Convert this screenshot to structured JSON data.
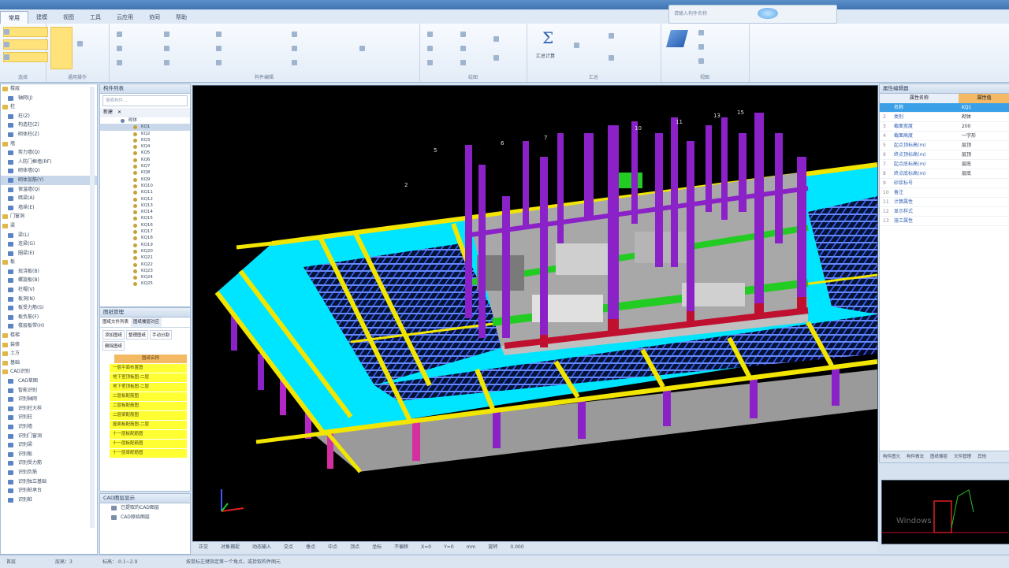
{
  "ribbon": {
    "tabs": [
      "常用",
      "建模",
      "视图",
      "工具",
      "云应用",
      "协同",
      "帮助"
    ],
    "groups": [
      "选择",
      "通用操作",
      "构件编辑",
      "绘图",
      "汇总",
      "视图"
    ],
    "summary_symbol": "Σ",
    "summary_label": "汇总计算",
    "search_placeholder": "请输入构件名称"
  },
  "nav_tree": {
    "items": [
      {
        "label": "楼层",
        "type": "folder"
      },
      {
        "label": "轴网(J)",
        "type": "item"
      },
      {
        "label": "柱",
        "type": "folder"
      },
      {
        "label": "柱(Z)",
        "type": "item"
      },
      {
        "label": "构造柱(Z)",
        "type": "item"
      },
      {
        "label": "砌体柱(Z)",
        "type": "item"
      },
      {
        "label": "墙",
        "type": "folder"
      },
      {
        "label": "剪力墙(Q)",
        "type": "item"
      },
      {
        "label": "人防门框墙(RF)",
        "type": "item"
      },
      {
        "label": "砌体墙(Q)",
        "type": "item"
      },
      {
        "label": "砌体加筋(Y)",
        "type": "item",
        "selected": true
      },
      {
        "label": "保温墙(Q)",
        "type": "item"
      },
      {
        "label": "暗梁(A)",
        "type": "item"
      },
      {
        "label": "墙垛(E)",
        "type": "item"
      },
      {
        "label": "门窗洞",
        "type": "folder"
      },
      {
        "label": "梁",
        "type": "folder"
      },
      {
        "label": "梁(L)",
        "type": "item"
      },
      {
        "label": "连梁(G)",
        "type": "item"
      },
      {
        "label": "圈梁(E)",
        "type": "item"
      },
      {
        "label": "板",
        "type": "folder"
      },
      {
        "label": "现浇板(B)",
        "type": "item"
      },
      {
        "label": "螺旋板(B)",
        "type": "item"
      },
      {
        "label": "柱帽(V)",
        "type": "item"
      },
      {
        "label": "板洞(N)",
        "type": "item"
      },
      {
        "label": "板受力筋(S)",
        "type": "item"
      },
      {
        "label": "板负筋(F)",
        "type": "item"
      },
      {
        "label": "楼层板带(H)",
        "type": "item"
      },
      {
        "label": "楼梯",
        "type": "folder"
      },
      {
        "label": "装修",
        "type": "folder"
      },
      {
        "label": "土方",
        "type": "folder"
      },
      {
        "label": "基础",
        "type": "folder"
      },
      {
        "label": "CAD识别",
        "type": "folder"
      },
      {
        "label": "CAD草图",
        "type": "item"
      },
      {
        "label": "智能识别",
        "type": "item"
      },
      {
        "label": "识别轴网",
        "type": "item"
      },
      {
        "label": "识别柱大样",
        "type": "item"
      },
      {
        "label": "识别柱",
        "type": "item"
      },
      {
        "label": "识别墙",
        "type": "item"
      },
      {
        "label": "识别门窗洞",
        "type": "item"
      },
      {
        "label": "识别梁",
        "type": "item"
      },
      {
        "label": "识别板",
        "type": "item"
      },
      {
        "label": "识别受力筋",
        "type": "item"
      },
      {
        "label": "识别负筋",
        "type": "item"
      },
      {
        "label": "识别独立基础",
        "type": "item"
      },
      {
        "label": "识别桩承台",
        "type": "item"
      },
      {
        "label": "识别桩",
        "type": "item"
      }
    ]
  },
  "component_list": {
    "title": "构件列表",
    "search_placeholder": "搜索构件...",
    "new_label": "新建",
    "delete_label": "✕",
    "root": "砌体",
    "items": [
      "KQ1",
      "KQ2",
      "KQ3",
      "KQ4",
      "KQ5",
      "KQ6",
      "KQ7",
      "KQ8",
      "KQ9",
      "KQ10",
      "KQ11",
      "KQ12",
      "KQ13",
      "KQ14",
      "KQ15",
      "KQ16",
      "KQ17",
      "KQ18",
      "KQ19",
      "KQ20",
      "KQ21",
      "KQ22",
      "KQ23",
      "KQ24",
      "KQ25"
    ]
  },
  "drawing_manager": {
    "title": "图纸管理",
    "tabs": [
      "图纸文件列表",
      "图纸楼层对应"
    ],
    "buttons": [
      "添加图纸",
      "整理图纸",
      "手动分割",
      "删除图纸"
    ],
    "column": "图纸名称",
    "sheets": [
      "一层平面布置图",
      "地下室顶板图-二层",
      "地下室顶板图-二层",
      "二层板配筋图",
      "二层板配筋图",
      "二层梁配筋图",
      "屋面板配筋图-二层",
      "十一层板配筋图",
      "十一层板配筋图",
      "十一层梁配筋图"
    ]
  },
  "cad_layers": {
    "title": "CAD图层显示",
    "items": [
      "已提取的CAD图层",
      "CAD原始图层"
    ]
  },
  "viewport": {
    "toolbar": [
      "正交",
      "对象捕捉",
      "动态输入",
      "交点",
      "垂点",
      "中点",
      "顶点",
      "坐标",
      "不偏移",
      "X=0",
      "Y=0",
      "mm",
      "旋转",
      "0.000"
    ]
  },
  "properties": {
    "title": "属性编辑器",
    "columns": [
      "属性名称",
      "属性值"
    ],
    "rows": [
      {
        "n": "1",
        "k": "名称",
        "v": "KQ1"
      },
      {
        "n": "2",
        "k": "类别",
        "v": "砌体"
      },
      {
        "n": "3",
        "k": "截面宽度",
        "v": "200"
      },
      {
        "n": "4",
        "k": "截面高度",
        "v": "一字形"
      },
      {
        "n": "5",
        "k": "起点顶标高(m)",
        "v": "层顶"
      },
      {
        "n": "6",
        "k": "终点顶标高(m)",
        "v": "层顶"
      },
      {
        "n": "7",
        "k": "起点底标高(m)",
        "v": "层底"
      },
      {
        "n": "8",
        "k": "终点底标高(m)",
        "v": "层底"
      },
      {
        "n": "9",
        "k": "砂浆标号",
        "v": ""
      },
      {
        "n": "10",
        "k": "备注",
        "v": ""
      },
      {
        "n": "11",
        "k": "计算属性",
        "v": ""
      },
      {
        "n": "12",
        "k": "显示样式",
        "v": ""
      },
      {
        "n": "13",
        "k": "施工属性",
        "v": ""
      }
    ]
  },
  "right_tabs": [
    "构件图元",
    "构件做法",
    "图纸楼层",
    "文件管理",
    "其他"
  ],
  "minimap_watermark": "Windows",
  "status": {
    "left": "首层",
    "floor_height": "层高：3",
    "elevation": "标高：-0.1~2.9",
    "hint": "按鼠标左键指定第一个角点，或拾取构件图元"
  },
  "colors": {
    "slab": "#00e5ff",
    "beam": "#ffee00",
    "column": "#9020d0",
    "green_beam": "#22cc22",
    "wall": "#a8a8a8",
    "rebar": "#3b5bff"
  }
}
